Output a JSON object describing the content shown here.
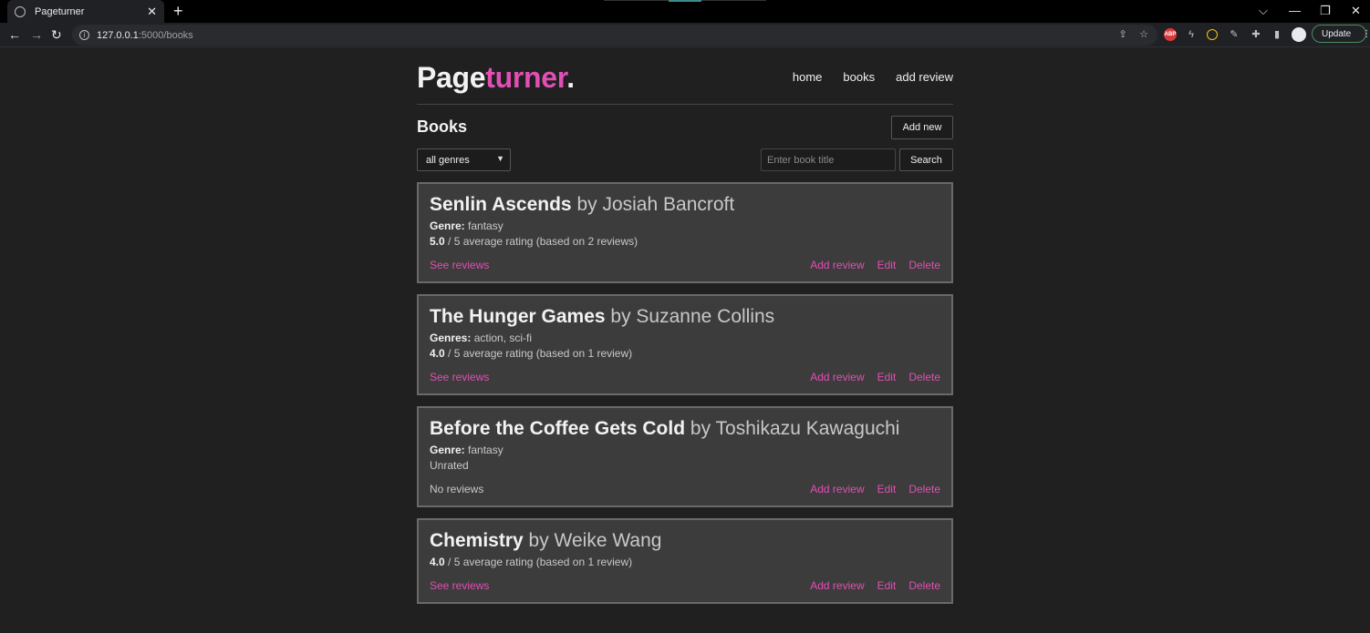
{
  "browser": {
    "tab_title": "Pageturner",
    "url_host": "127.0.0.1",
    "url_path": ":5000/books",
    "update_label": "Update"
  },
  "site": {
    "logo_main": "Page",
    "logo_accent": "turner",
    "logo_dot": ".",
    "nav": [
      "home",
      "books",
      "add review"
    ],
    "accent_color": "#e14fb3"
  },
  "books_page": {
    "title": "Books",
    "add_new_label": "Add new",
    "genre_filter_value": "all genres",
    "search_placeholder": "Enter book title",
    "search_label": "Search"
  },
  "books": [
    {
      "title": "Senlin Ascends",
      "by": "by Josiah Bancroft",
      "genre_label": "Genre:",
      "genres": "fantasy",
      "rating": "5.0",
      "rating_text": "/ 5 average rating (based on 2 reviews)",
      "reviews_link": "See reviews"
    },
    {
      "title": "The Hunger Games",
      "by": "by Suzanne Collins",
      "genre_label": "Genres:",
      "genres": "action, sci-fi",
      "rating": "4.0",
      "rating_text": "/ 5 average rating (based on 1 review)",
      "reviews_link": "See reviews"
    },
    {
      "title": "Before the Coffee Gets Cold",
      "by": "by Toshikazu Kawaguchi",
      "genre_label": "Genre:",
      "genres": "fantasy",
      "unrated_text": "Unrated",
      "no_reviews_text": "No reviews"
    },
    {
      "title": "Chemistry",
      "by": "by Weike Wang",
      "rating": "4.0",
      "rating_text": "/ 5 average rating (based on 1 review)",
      "reviews_link": "See reviews"
    }
  ],
  "card_actions": {
    "add_review": "Add review",
    "edit": "Edit",
    "delete": "Delete"
  }
}
